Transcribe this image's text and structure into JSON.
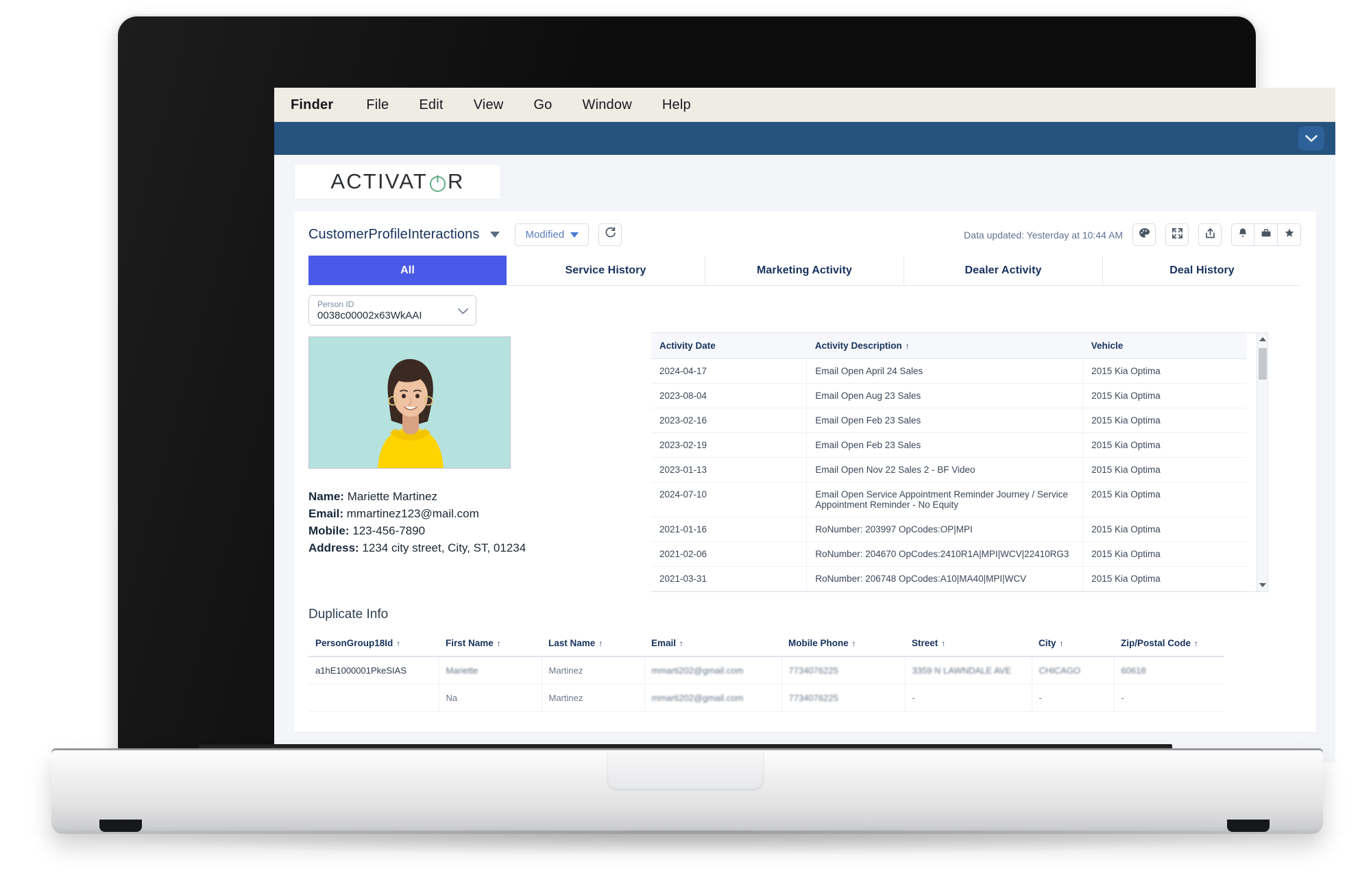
{
  "os_menu": {
    "items": [
      "Finder",
      "File",
      "Edit",
      "View",
      "Go",
      "Window",
      "Help"
    ]
  },
  "app": {
    "logo_text_before": "ACTIVAT",
    "logo_text_after": "R",
    "brand_accent": "#5aa97f",
    "header_bar_color": "#25527f",
    "chevron_icon": "chevron-down-icon"
  },
  "toolbar": {
    "dataset_name": "CustomerProfileInteractions",
    "dataset_caret_icon": "caret-down-icon",
    "filter_label": "Modified",
    "filter_caret_icon": "caret-down-icon",
    "refresh_icon": "refresh-icon",
    "updated_text": "Data updated: Yesterday at 10:44 AM",
    "icons": [
      {
        "name": "palette-icon",
        "glyph": "palette"
      },
      {
        "name": "expand-icon",
        "glyph": "expand"
      },
      {
        "name": "share-icon",
        "glyph": "share"
      },
      {
        "name": "bell-icon",
        "glyph": "bell"
      },
      {
        "name": "briefcase-icon",
        "glyph": "briefcase"
      },
      {
        "name": "star-icon",
        "glyph": "star"
      }
    ]
  },
  "tabs": [
    {
      "label": "All",
      "active": true
    },
    {
      "label": "Service History",
      "active": false
    },
    {
      "label": "Marketing Activity",
      "active": false
    },
    {
      "label": "Dealer Activity",
      "active": false
    },
    {
      "label": "Deal History",
      "active": false
    }
  ],
  "person_select": {
    "caption": "Person ID",
    "value": "0038c00002x63WkAAI",
    "chevron_icon": "chevron-down-icon"
  },
  "profile": {
    "photo_alt": "customer-portrait",
    "labels": {
      "name": "Name:",
      "email": "Email:",
      "mobile": "Mobile:",
      "address": "Address:"
    },
    "name": "Mariette Martinez",
    "email": "mmartinez123@mail.com",
    "mobile": "123-456-7890",
    "address": "1234 city street, City, ST, 01234"
  },
  "activity_table": {
    "columns": [
      {
        "label": "Activity Date",
        "sorted": false
      },
      {
        "label": "Activity Description",
        "sorted": true,
        "sort_icon": "sort-ascending-icon"
      },
      {
        "label": "Vehicle",
        "sorted": false
      }
    ],
    "rows": [
      [
        "2024-04-17",
        "Email Open April 24 Sales",
        "2015 Kia Optima"
      ],
      [
        "2023-08-04",
        "Email Open Aug 23 Sales",
        "2015 Kia Optima"
      ],
      [
        "2023-02-16",
        "Email Open Feb 23 Sales",
        "2015 Kia Optima"
      ],
      [
        "2023-02-19",
        "Email Open Feb 23 Sales",
        "2015 Kia Optima"
      ],
      [
        "2023-01-13",
        "Email Open Nov 22 Sales 2 - BF Video",
        "2015 Kia Optima"
      ],
      [
        "2024-07-10",
        "Email Open Service Appointment Reminder Journey / Service Appointment Reminder - No Equity",
        "2015 Kia Optima"
      ],
      [
        "2021-01-16",
        "RoNumber: 203997 OpCodes:OP|MPI",
        "2015 Kia Optima"
      ],
      [
        "2021-02-06",
        "RoNumber: 204670 OpCodes:2410R1A|MPI|WCV|22410RG3",
        "2015 Kia Optima"
      ],
      [
        "2021-03-31",
        "RoNumber: 206748 OpCodes:A10|MA40|MPI|WCV",
        "2015 Kia Optima"
      ]
    ],
    "scrollbar": {
      "name": "vertical-scrollbar"
    }
  },
  "duplicate_info": {
    "title": "Duplicate Info",
    "columns": [
      "PersonGroup18Id",
      "First Name",
      "Last Name",
      "Email",
      "Mobile Phone",
      "Street",
      "City",
      "Zip/Postal Code"
    ],
    "sort_icon": "sort-ascending-icon",
    "rows": [
      {
        "cells": [
          "a1hE1000001PkeSIAS",
          "Mariette",
          "Martinez",
          "mmarti202@gmail.com",
          "7734076225",
          "3359 N LAWNDALE AVE",
          "CHICAGO",
          "60618"
        ],
        "redacted": [
          false,
          true,
          false,
          true,
          true,
          true,
          true,
          true
        ]
      },
      {
        "cells": [
          "",
          "Na",
          "Martinez",
          "mmarti202@gmail.com",
          "7734076225",
          "-",
          "-",
          "-"
        ],
        "redacted": [
          false,
          false,
          false,
          true,
          true,
          false,
          false,
          false
        ]
      }
    ]
  }
}
